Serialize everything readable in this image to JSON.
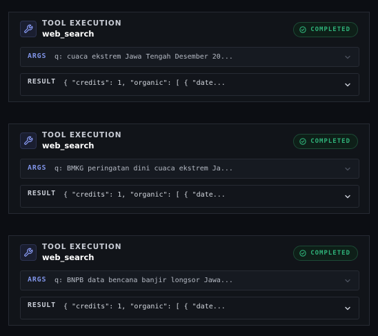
{
  "colors": {
    "background": "#0c0e13",
    "card": "#111419",
    "accent": "#7f93e6",
    "completed": "#2fb37a"
  },
  "cards": [
    {
      "icon": "wrench-icon",
      "kicker": "TOOL EXECUTION",
      "tool_name": "web_search",
      "status": "COMPLETED",
      "args_label": "ARGS",
      "args_value": "q: cuaca ekstrem Jawa Tengah Desember 20...",
      "result_label": "RESULT",
      "result_value": "{ \"credits\": 1, \"organic\": [ { \"date..."
    },
    {
      "icon": "wrench-icon",
      "kicker": "TOOL EXECUTION",
      "tool_name": "web_search",
      "status": "COMPLETED",
      "args_label": "ARGS",
      "args_value": "q: BMKG peringatan dini cuaca ekstrem Ja...",
      "result_label": "RESULT",
      "result_value": "{ \"credits\": 1, \"organic\": [ { \"date..."
    },
    {
      "icon": "wrench-icon",
      "kicker": "TOOL EXECUTION",
      "tool_name": "web_search",
      "status": "COMPLETED",
      "args_label": "ARGS",
      "args_value": "q: BNPB data bencana banjir longsor Jawa...",
      "result_label": "RESULT",
      "result_value": "{ \"credits\": 1, \"organic\": [ { \"date..."
    }
  ]
}
